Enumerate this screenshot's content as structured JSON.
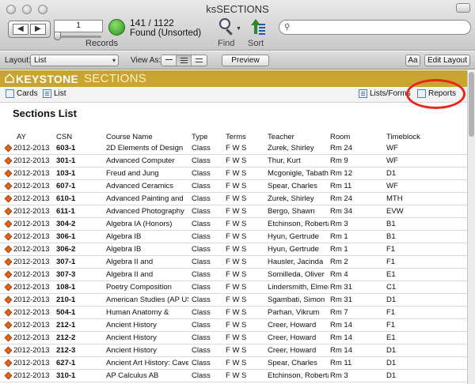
{
  "window": {
    "title": "ksSECTIONS"
  },
  "toolbar": {
    "record_number": "1",
    "records_label": "Records",
    "found_count": "141 / 1122",
    "found_status": "Found (Unsorted)",
    "find_label": "Find",
    "sort_label": "Sort",
    "search_placeholder": ""
  },
  "layoutbar": {
    "layout_label": "Layout:",
    "layout_value": "List",
    "view_as_label": "View As:",
    "preview_label": "Preview",
    "aa_label": "Aa",
    "edit_layout_label": "Edit Layout"
  },
  "banner": {
    "brand": "KEYSTONE",
    "module": "SECTIONS",
    "color": "#c9a52f"
  },
  "subnav": {
    "cards": "Cards",
    "list": "List",
    "lists_forms": "Lists/Forms",
    "reports": "Reports"
  },
  "page_title": "Sections List",
  "table": {
    "headers": {
      "ay": "AY",
      "csn": "CSN",
      "course": "Course Name",
      "type": "Type",
      "terms": "Terms",
      "teacher": "Teacher",
      "room": "Room",
      "timeblock": "Timeblock"
    },
    "rows": [
      {
        "ay": "2012-2013",
        "csn": "603-1",
        "course": "2D Elements of Design",
        "type": "Class",
        "terms": "F W S",
        "teacher": "Zurek, Shirley",
        "room": "Rm 24",
        "timeblock": "WF"
      },
      {
        "ay": "2012-2013",
        "csn": "301-1",
        "course": "Advanced Computer",
        "type": "Class",
        "terms": "F W S",
        "teacher": "Thur, Kurt",
        "room": "Rm 9",
        "timeblock": "WF"
      },
      {
        "ay": "2012-2013",
        "csn": "103-1",
        "course": "Freud and Jung",
        "type": "Class",
        "terms": "F W S",
        "teacher": "Mcgonigle, Tabatha",
        "room": "Rm 12",
        "timeblock": "D1"
      },
      {
        "ay": "2012-2013",
        "csn": "607-1",
        "course": "Advanced Ceramics",
        "type": "Class",
        "terms": "F W S",
        "teacher": "Spear, Charles",
        "room": "Rm 11",
        "timeblock": "WF"
      },
      {
        "ay": "2012-2013",
        "csn": "610-1",
        "course": "Advanced Painting and",
        "type": "Class",
        "terms": "F W S",
        "teacher": "Zurek, Shirley",
        "room": "Rm 24",
        "timeblock": "MTH"
      },
      {
        "ay": "2012-2013",
        "csn": "611-1",
        "course": "Advanced Photography",
        "type": "Class",
        "terms": "F W S",
        "teacher": "Bergo, Shawn",
        "room": "Rm 34",
        "timeblock": "EVW"
      },
      {
        "ay": "2012-2013",
        "csn": "304-2",
        "course": "Algebra IA (Honors)",
        "type": "Class",
        "terms": "F W S",
        "teacher": "Etchinson, Roberta",
        "room": "Rm 3",
        "timeblock": "B1"
      },
      {
        "ay": "2012-2013",
        "csn": "306-1",
        "course": "Algebra IB",
        "type": "Class",
        "terms": "F W S",
        "teacher": "Hyun, Gertrude",
        "room": "Rm 1",
        "timeblock": "B1"
      },
      {
        "ay": "2012-2013",
        "csn": "306-2",
        "course": "Algebra IB",
        "type": "Class",
        "terms": "F W S",
        "teacher": "Hyun, Gertrude",
        "room": "Rm 1",
        "timeblock": "F1"
      },
      {
        "ay": "2012-2013",
        "csn": "307-1",
        "course": "Algebra II and",
        "type": "Class",
        "terms": "F W S",
        "teacher": "Hausler, Jacinda",
        "room": "Rm 2",
        "timeblock": "F1"
      },
      {
        "ay": "2012-2013",
        "csn": "307-3",
        "course": "Algebra II and",
        "type": "Class",
        "terms": "F W S",
        "teacher": "Somilleda, Oliver",
        "room": "Rm 4",
        "timeblock": "E1"
      },
      {
        "ay": "2012-2013",
        "csn": "108-1",
        "course": "Poetry Composition",
        "type": "Class",
        "terms": "F W S",
        "teacher": "Lindersmith, Elmer",
        "room": "Rm 31",
        "timeblock": "C1"
      },
      {
        "ay": "2012-2013",
        "csn": "210-1",
        "course": "American Studies (AP US",
        "type": "Class",
        "terms": "F W S",
        "teacher": "Sgambati, Simon",
        "room": "Rm 31",
        "timeblock": "D1"
      },
      {
        "ay": "2012-2013",
        "csn": "504-1",
        "course": "Human Anatomy &",
        "type": "Class",
        "terms": "F W S",
        "teacher": "Parhan, Vikrum",
        "room": "Rm 7",
        "timeblock": "F1"
      },
      {
        "ay": "2012-2013",
        "csn": "212-1",
        "course": "Ancient History",
        "type": "Class",
        "terms": "F W S",
        "teacher": "Creer, Howard",
        "room": "Rm 14",
        "timeblock": "F1"
      },
      {
        "ay": "2012-2013",
        "csn": "212-2",
        "course": "Ancient History",
        "type": "Class",
        "terms": "F W S",
        "teacher": "Creer, Howard",
        "room": "Rm 14",
        "timeblock": "E1"
      },
      {
        "ay": "2012-2013",
        "csn": "212-3",
        "course": "Ancient History",
        "type": "Class",
        "terms": "F W S",
        "teacher": "Creer, Howard",
        "room": "Rm 14",
        "timeblock": "D1"
      },
      {
        "ay": "2012-2013",
        "csn": "627-1",
        "course": "Ancient Art History: Cave",
        "type": "Class",
        "terms": "F W S",
        "teacher": "Spear, Charles",
        "room": "Rm 11",
        "timeblock": "D1"
      },
      {
        "ay": "2012-2013",
        "csn": "310-1",
        "course": "AP Calculus AB",
        "type": "Class",
        "terms": "F W S",
        "teacher": "Etchinson, Roberta",
        "room": "Rm 3",
        "timeblock": "D1"
      }
    ]
  }
}
